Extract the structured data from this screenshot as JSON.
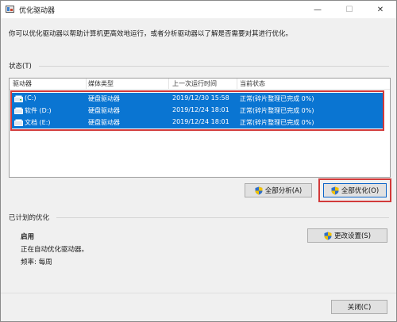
{
  "window": {
    "title": "优化驱动器",
    "controls": {
      "minimize": "—",
      "maximize": "☐",
      "close": "✕"
    }
  },
  "description": "你可以优化驱动器以帮助计算机更高效地运行，或者分析驱动器以了解是否需要对其进行优化。",
  "status_section": {
    "label": "状态(T)",
    "columns": [
      "驱动器",
      "媒体类型",
      "上一次运行时间",
      "当前状态"
    ],
    "rows": [
      {
        "drive": "(C:)",
        "media": "硬盘驱动器",
        "last_run": "2019/12/30 15:58",
        "status": "正常(碎片整理已完成 0%)",
        "icon": "drive-icon"
      },
      {
        "drive": "软件 (D:)",
        "media": "硬盘驱动器",
        "last_run": "2019/12/24 18:01",
        "status": "正常(碎片整理已完成 0%)",
        "icon": "drive-icon"
      },
      {
        "drive": "文档 (E:)",
        "media": "硬盘驱动器",
        "last_run": "2019/12/24 18:01",
        "status": "正常(碎片整理已完成 0%)",
        "icon": "drive-icon"
      }
    ],
    "selection_color": "#0a75d2",
    "highlight_color": "#d23a3a"
  },
  "buttons": {
    "analyze_all": "全部分析(A)",
    "optimize_all": "全部优化(O)",
    "change_settings": "更改设置(S)",
    "close": "关闭(C)"
  },
  "scheduled": {
    "label": "已计划的优化",
    "status": "启用",
    "detail": "正在自动优化驱动器。",
    "frequency": "频率: 每周"
  }
}
